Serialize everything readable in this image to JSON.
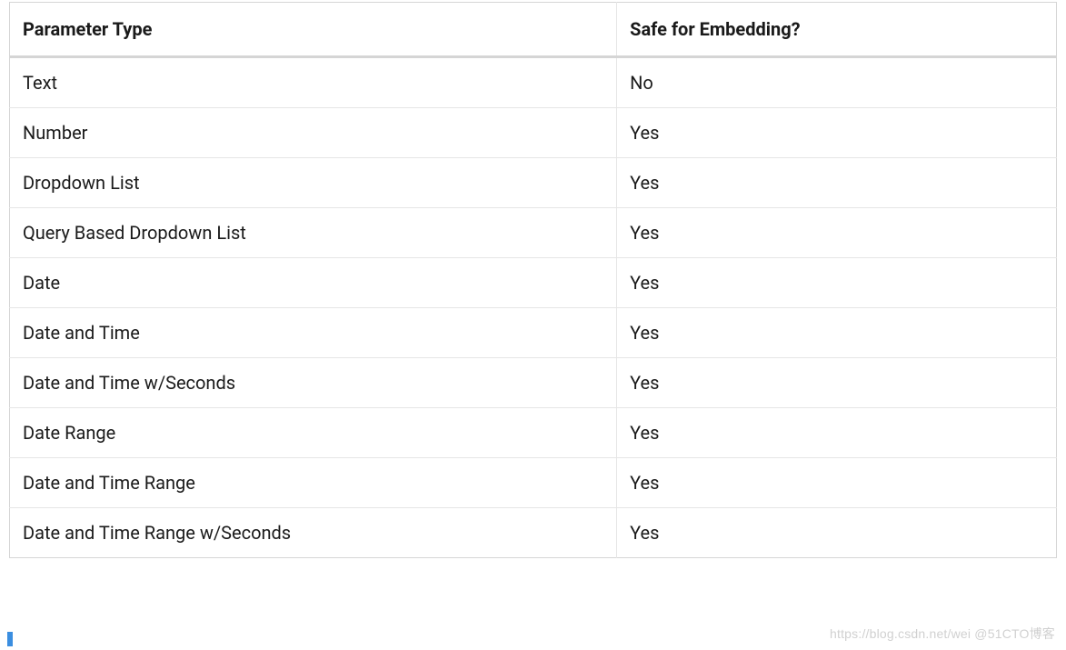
{
  "table": {
    "headers": {
      "col1": "Parameter Type",
      "col2": "Safe for Embedding?"
    },
    "rows": [
      {
        "param": "Text",
        "safe": "No"
      },
      {
        "param": "Number",
        "safe": "Yes"
      },
      {
        "param": "Dropdown List",
        "safe": "Yes"
      },
      {
        "param": "Query Based Dropdown List",
        "safe": "Yes"
      },
      {
        "param": "Date",
        "safe": "Yes"
      },
      {
        "param": "Date and Time",
        "safe": "Yes"
      },
      {
        "param": "Date and Time w/Seconds",
        "safe": "Yes"
      },
      {
        "param": "Date Range",
        "safe": "Yes"
      },
      {
        "param": "Date and Time Range",
        "safe": "Yes"
      },
      {
        "param": "Date and Time Range w/Seconds",
        "safe": "Yes"
      }
    ]
  },
  "watermark": "https://blog.csdn.net/wei @51CTO博客"
}
